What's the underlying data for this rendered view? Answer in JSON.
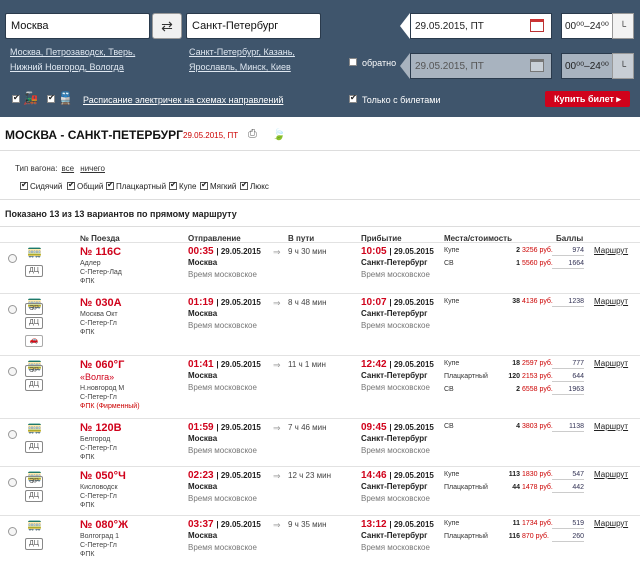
{
  "search": {
    "from": "Москва",
    "to": "Санкт-Петербург",
    "swap_icon": "swap-arrows-icon",
    "from_links": [
      "Москва, Петрозаводск, Тверь,",
      "Нижний Новгород, Вологда"
    ],
    "to_links": [
      "Санкт-Петербург, Казань,",
      "Ярославль, Минск, Киев"
    ],
    "date": "29.05.2015, ПТ",
    "time": "00⁰⁰–24⁰⁰",
    "return_label": "обратно",
    "return_date": "29.05.2015, ПТ",
    "return_time": "00⁰⁰–24⁰⁰",
    "schedule_link": "Расписание электричек на схемах направлений",
    "only_tickets": "Только с билетами",
    "buy": "Купить билет ▸"
  },
  "route": {
    "title": "МОСКВА - САНКТ-ПЕТЕРБУРГ",
    "date": "29.05.2015, ПТ"
  },
  "filter": {
    "label": "Тип вагона:",
    "all": "все",
    "none": "ничего",
    "types": [
      "Сидячий",
      "Общий",
      "Плацкартный",
      "Купе",
      "Мягкий",
      "Люкс"
    ]
  },
  "shown": "Показано 13 из 13 вариантов по прямому маршруту",
  "headers": {
    "num": "№ Поезда",
    "dep": "Отправление",
    "travel": "В пути",
    "arr": "Прибытие",
    "seats": "Места/стоимость",
    "points": "Баллы"
  },
  "trains": [
    {
      "num": "№ 116С",
      "name": "",
      "lines": [
        "Адлер",
        "С-Петер-Лад",
        "ФПК"
      ],
      "boxes": [
        "ДЦ"
      ],
      "dep": "00:35",
      "arr": "10:05",
      "travel": "9 ч 30 мин",
      "seats": [
        {
          "cls": "Купе",
          "n": "2",
          "p": "3256 руб.",
          "pts": "974"
        },
        {
          "cls": "СВ",
          "n": "1",
          "p": "5560 руб.",
          "pts": "1664"
        }
      ]
    },
    {
      "num": "№ 030А",
      "name": "",
      "lines": [
        "Москва Окт",
        "С-Петер-Гл",
        "ФПК"
      ],
      "boxes": [
        "ЭР",
        "ДЦ"
      ],
      "dep": "01:19",
      "arr": "10:07",
      "travel": "8 ч 48 мин",
      "seats": [
        {
          "cls": "Купе",
          "n": "38",
          "p": "4136 руб.",
          "pts": "1238"
        }
      ]
    },
    {
      "num": "№ 060°Г",
      "name": "«Волга»",
      "lines": [
        "Н.новгород М",
        "С-Петер-Гл",
        "ФПК (Фирменный)"
      ],
      "boxes": [
        "ЭР",
        "ДЦ"
      ],
      "dep": "01:41",
      "arr": "12:42",
      "travel": "11 ч 1 мин",
      "seats": [
        {
          "cls": "Купе",
          "n": "18",
          "p": "2597 руб.",
          "pts": "777"
        },
        {
          "cls": "Плацкартный",
          "n": "120",
          "p": "2153 руб.",
          "pts": "644"
        },
        {
          "cls": "СВ",
          "n": "2",
          "p": "6558 руб.",
          "pts": "1963"
        }
      ]
    },
    {
      "num": "№ 120В",
      "name": "",
      "lines": [
        "Белгород",
        "С-Петер-Гл",
        "ФПК"
      ],
      "boxes": [
        "ДЦ"
      ],
      "dep": "01:59",
      "arr": "09:45",
      "travel": "7 ч 46 мин",
      "seats": [
        {
          "cls": "СВ",
          "n": "4",
          "p": "3803 руб.",
          "pts": "1138"
        }
      ]
    },
    {
      "num": "№ 050°Ч",
      "name": "",
      "lines": [
        "Кисловодск",
        "С-Петер-Гл",
        "ФПК"
      ],
      "boxes": [
        "ЭР",
        "ДЦ"
      ],
      "dep": "02:23",
      "arr": "14:46",
      "travel": "12 ч 23 мин",
      "seats": [
        {
          "cls": "Купе",
          "n": "113",
          "p": "1830 руб.",
          "pts": "547"
        },
        {
          "cls": "Плацкартный",
          "n": "44",
          "p": "1478 руб.",
          "pts": "442"
        }
      ]
    },
    {
      "num": "№ 080°Ж",
      "name": "",
      "lines": [
        "Волгоград 1",
        "С-Петер-Гл",
        "ФПК"
      ],
      "boxes": [
        "ДЦ"
      ],
      "dep": "03:37",
      "arr": "13:12",
      "travel": "9 ч 35 мин",
      "seats": [
        {
          "cls": "Купе",
          "n": "11",
          "p": "1734 руб.",
          "pts": "519"
        },
        {
          "cls": "Плацкартный",
          "n": "116",
          "p": "870 руб.",
          "pts": "260"
        }
      ]
    }
  ],
  "common": {
    "date": "29.05.2015",
    "from": "Москва",
    "to": "Санкт-Петербург",
    "tz": "Время московское",
    "route": "Маршрут",
    "arrow": "⇒"
  }
}
